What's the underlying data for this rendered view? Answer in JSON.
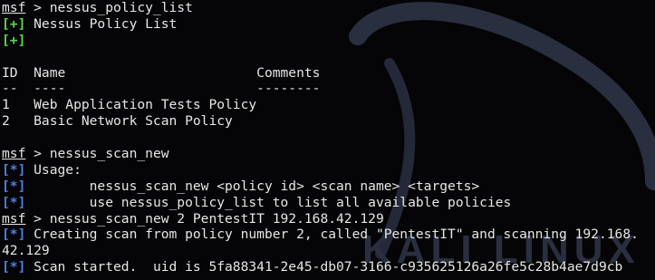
{
  "colors": {
    "background": "#050507",
    "text": "#e6e6e6",
    "success_marker": "#56d84a",
    "info_marker": "#4f7fe0",
    "watermark": "#2a2f3f"
  },
  "watermark": {
    "text": "KALI LINUX"
  },
  "terminal": {
    "lines": [
      [
        {
          "t": "msf",
          "c": "msf"
        },
        {
          "t": " > nessus_policy_list",
          "c": "text"
        }
      ],
      [
        {
          "t": "[+]",
          "c": "plus"
        },
        {
          "t": " Nessus Policy List",
          "c": "text"
        }
      ],
      [
        {
          "t": "[+]",
          "c": "plus"
        }
      ],
      [],
      [
        {
          "t": "ID  Name                        Comments",
          "c": "text"
        }
      ],
      [
        {
          "t": "--  ----                        --------",
          "c": "text"
        }
      ],
      [
        {
          "t": "1   Web Application Tests Policy",
          "c": "text"
        }
      ],
      [
        {
          "t": "2   Basic Network Scan Policy",
          "c": "text"
        }
      ],
      [],
      [
        {
          "t": "msf",
          "c": "msf"
        },
        {
          "t": " > nessus_scan_new",
          "c": "text"
        }
      ],
      [
        {
          "t": "[*]",
          "c": "star"
        },
        {
          "t": " Usage:",
          "c": "text"
        }
      ],
      [
        {
          "t": "[*]",
          "c": "star"
        },
        {
          "t": "        nessus_scan_new <policy id> <scan name> <targets>",
          "c": "text"
        }
      ],
      [
        {
          "t": "[*]",
          "c": "star"
        },
        {
          "t": "        use nessus_policy_list to list all available policies",
          "c": "text"
        }
      ],
      [
        {
          "t": "msf",
          "c": "msf"
        },
        {
          "t": " > nessus_scan_new 2 PentestIT 192.168.42.129",
          "c": "text"
        }
      ],
      [
        {
          "t": "[*]",
          "c": "star"
        },
        {
          "t": " Creating scan from policy number 2, called \"PentestIT\" and scanning 192.168.",
          "c": "text"
        }
      ],
      [
        {
          "t": "42.129",
          "c": "text"
        }
      ],
      [
        {
          "t": "[*]",
          "c": "star"
        },
        {
          "t": " Scan started.  uid is 5fa88341-2e45-db07-3166-c935625126a26fe5c28b4ae7d9cb",
          "c": "text"
        }
      ]
    ]
  }
}
